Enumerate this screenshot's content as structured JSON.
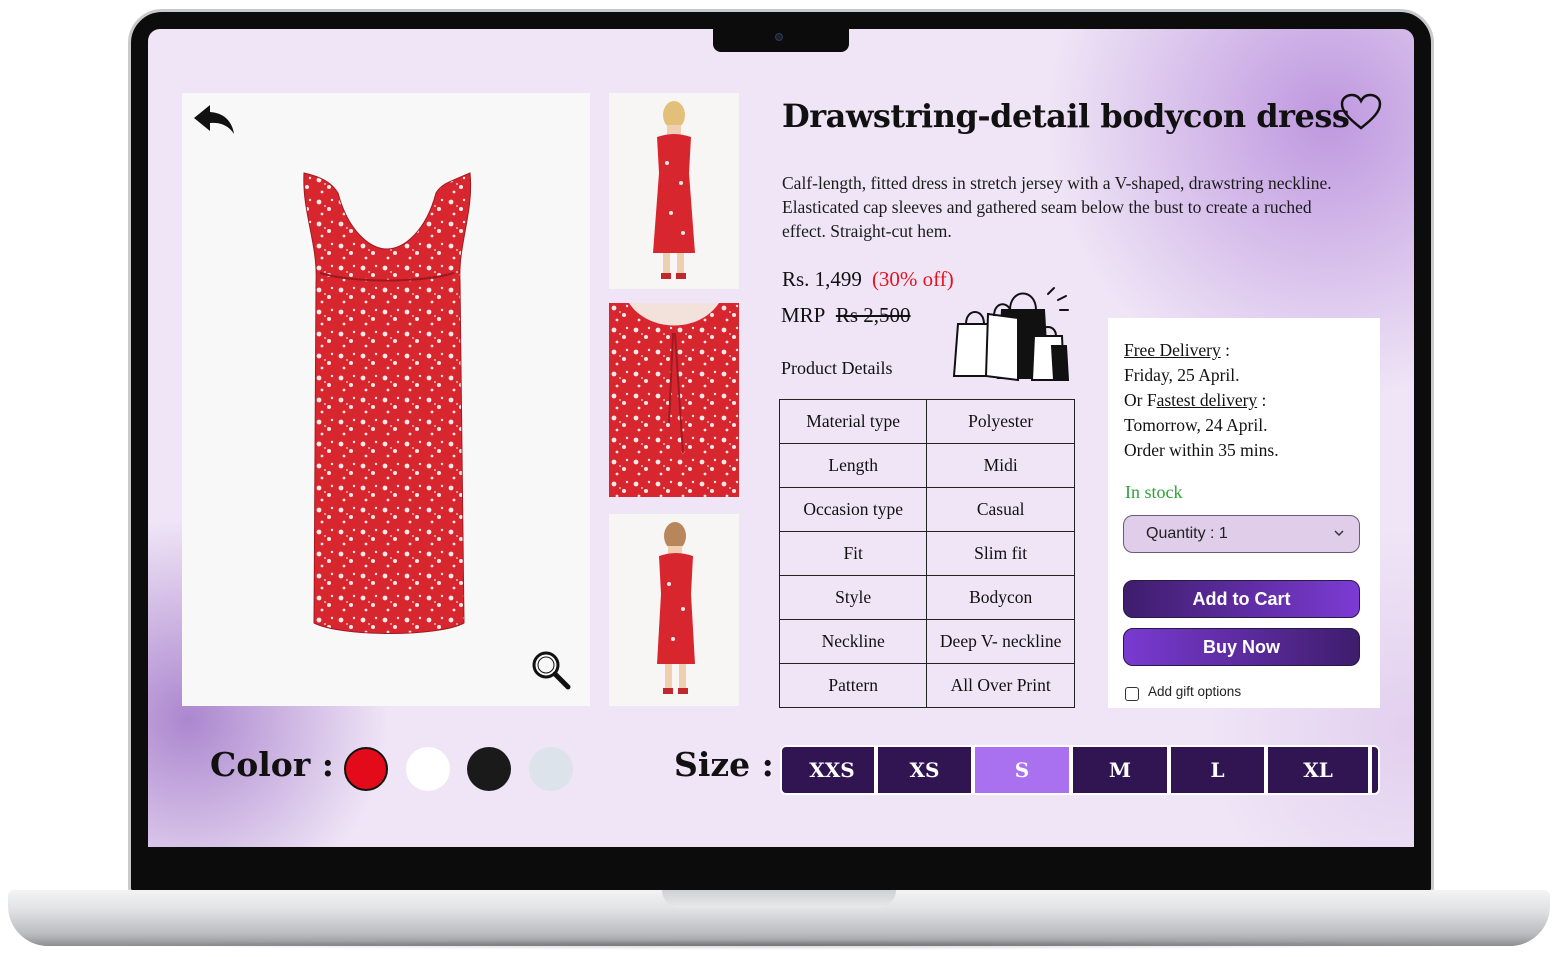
{
  "product": {
    "title": "Drawstring-detail bodycon dress",
    "description": "Calf-length, fitted dress in stretch jersey with a V-shaped, drawstring neckline. Elasticated cap sleeves and gathered seam below the bust to create a ruched effect. Straight-cut hem.",
    "price": "Rs. 1,499",
    "discount": "(30% off)",
    "mrp_label": "MRP",
    "mrp_value": "Rs 2,500",
    "details_label": "Product Details"
  },
  "specs": [
    {
      "label": "Material type",
      "value": "Polyester"
    },
    {
      "label": "Length",
      "value": "Midi"
    },
    {
      "label": "Occasion type",
      "value": "Casual"
    },
    {
      "label": "Fit",
      "value": "Slim fit"
    },
    {
      "label": "Style",
      "value": "Bodycon"
    },
    {
      "label": "Neckline",
      "value": "Deep V- neckline"
    },
    {
      "label": "Pattern",
      "value": "All Over Print"
    }
  ],
  "delivery": {
    "free_label": "Free Delivery",
    "free_suffix": " :",
    "free_date": "Friday, 25 April.",
    "fastest_prefix": "Or F",
    "fastest_label": "astest delivery",
    "fastest_suffix": " :",
    "fastest_date": "Tomorrow, 24 April.",
    "order_within": "Order within 35 mins."
  },
  "stock_status": "In stock",
  "quantity_label": "Quantity : 1",
  "buttons": {
    "add_to_cart": "Add to Cart",
    "buy_now": "Buy Now"
  },
  "gift_option": "Add gift options",
  "color": {
    "label": "Color :",
    "options": [
      "#e30a19",
      "#ffffff",
      "#1a1a1a",
      "#dde3ea"
    ],
    "selected_index": 0
  },
  "size": {
    "label": "Size :",
    "options": [
      "XXS",
      "XS",
      "S",
      "M",
      "L",
      "XL"
    ],
    "selected": "S"
  },
  "colors": {
    "accent_dark": "#311553",
    "accent_selected": "#a970ef",
    "button_gradient_start": "#3e1d6c",
    "button_gradient_end": "#7c3bd4",
    "discount": "#e3141d",
    "in_stock": "#2ea33a"
  },
  "icons": [
    "back-arrow-icon",
    "heart-icon",
    "zoom-icon",
    "shopping-bags-icon",
    "chevron-down-icon"
  ]
}
